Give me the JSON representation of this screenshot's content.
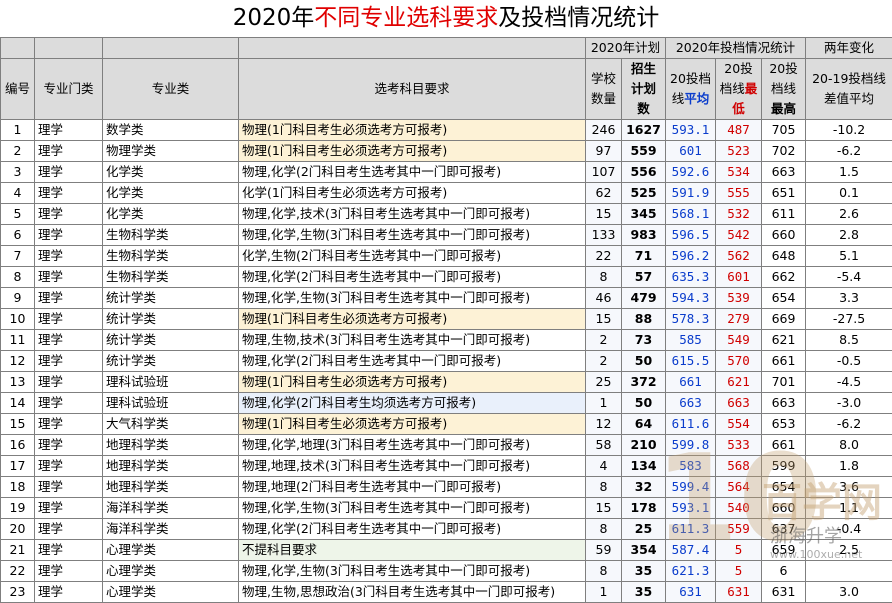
{
  "title": {
    "pre": "2020年",
    "highlight": "不同专业选科要求",
    "post": "及投档情况统计"
  },
  "headers": {
    "plan_group": "2020年计划",
    "admit_group": "2020年投档情况统计",
    "change_group": "两年变化",
    "no": "编号",
    "category": "专业门类",
    "major": "专业类",
    "requirement": "选考科目要求",
    "schools": "学校数量",
    "enroll": "招生计划数",
    "avg_prefix": "20投档线",
    "avg_suffix": "平均",
    "min_prefix": "20投档线",
    "min_suffix": "最低",
    "max_prefix": "20投档线",
    "max_suffix": "最高",
    "diff": "20-19投档线差值平均"
  },
  "rows": [
    {
      "no": "1",
      "category": "理学",
      "major": "数学类",
      "requirement": "物理(1门科目考生必须选考方可报考)",
      "schools": "246",
      "enroll": "1627",
      "avg": "593.1",
      "min": "487",
      "max": "705",
      "diff": "-10.2",
      "hl": "y"
    },
    {
      "no": "2",
      "category": "理学",
      "major": "物理学类",
      "requirement": "物理(1门科目考生必须选考方可报考)",
      "schools": "97",
      "enroll": "559",
      "avg": "601",
      "min": "523",
      "max": "702",
      "diff": "-6.2",
      "hl": "y"
    },
    {
      "no": "3",
      "category": "理学",
      "major": "化学类",
      "requirement": "物理,化学(2门科目考生选考其中一门即可报考)",
      "schools": "107",
      "enroll": "556",
      "avg": "592.6",
      "min": "534",
      "max": "663",
      "diff": "1.5",
      "hl": ""
    },
    {
      "no": "4",
      "category": "理学",
      "major": "化学类",
      "requirement": "化学(1门科目考生必须选考方可报考)",
      "schools": "62",
      "enroll": "525",
      "avg": "591.9",
      "min": "555",
      "max": "651",
      "diff": "0.1",
      "hl": ""
    },
    {
      "no": "5",
      "category": "理学",
      "major": "化学类",
      "requirement": "物理,化学,技术(3门科目考生选考其中一门即可报考)",
      "schools": "15",
      "enroll": "345",
      "avg": "568.1",
      "min": "532",
      "max": "611",
      "diff": "2.6",
      "hl": ""
    },
    {
      "no": "6",
      "category": "理学",
      "major": "生物科学类",
      "requirement": "物理,化学,生物(3门科目考生选考其中一门即可报考)",
      "schools": "133",
      "enroll": "983",
      "avg": "596.5",
      "min": "542",
      "max": "660",
      "diff": "2.8",
      "hl": ""
    },
    {
      "no": "7",
      "category": "理学",
      "major": "生物科学类",
      "requirement": "化学,生物(2门科目考生选考其中一门即可报考)",
      "schools": "22",
      "enroll": "71",
      "avg": "596.2",
      "min": "562",
      "max": "648",
      "diff": "5.1",
      "hl": ""
    },
    {
      "no": "8",
      "category": "理学",
      "major": "生物科学类",
      "requirement": "物理,化学(2门科目考生选考其中一门即可报考)",
      "schools": "8",
      "enroll": "57",
      "avg": "635.3",
      "min": "601",
      "max": "662",
      "diff": "-5.4",
      "hl": ""
    },
    {
      "no": "9",
      "category": "理学",
      "major": "统计学类",
      "requirement": "物理,化学,生物(3门科目考生选考其中一门即可报考)",
      "schools": "46",
      "enroll": "479",
      "avg": "594.3",
      "min": "539",
      "max": "654",
      "diff": "3.3",
      "hl": ""
    },
    {
      "no": "10",
      "category": "理学",
      "major": "统计学类",
      "requirement": "物理(1门科目考生必须选考方可报考)",
      "schools": "15",
      "enroll": "88",
      "avg": "578.3",
      "min": "279",
      "max": "669",
      "diff": "-27.5",
      "hl": "y"
    },
    {
      "no": "11",
      "category": "理学",
      "major": "统计学类",
      "requirement": "物理,生物,技术(3门科目考生选考其中一门即可报考)",
      "schools": "2",
      "enroll": "73",
      "avg": "585",
      "min": "549",
      "max": "621",
      "diff": "8.5",
      "hl": ""
    },
    {
      "no": "12",
      "category": "理学",
      "major": "统计学类",
      "requirement": "物理,化学(2门科目考生选考其中一门即可报考)",
      "schools": "2",
      "enroll": "50",
      "avg": "615.5",
      "min": "570",
      "max": "661",
      "diff": "-0.5",
      "hl": ""
    },
    {
      "no": "13",
      "category": "理学",
      "major": "理科试验班",
      "requirement": "物理(1门科目考生必须选考方可报考)",
      "schools": "25",
      "enroll": "372",
      "avg": "661",
      "min": "621",
      "max": "701",
      "diff": "-4.5",
      "hl": "y"
    },
    {
      "no": "14",
      "category": "理学",
      "major": "理科试验班",
      "requirement": "物理,化学(2门科目考生均须选考方可报考)",
      "schools": "1",
      "enroll": "50",
      "avg": "663",
      "min": "663",
      "max": "663",
      "diff": "-3.0",
      "hl": "b"
    },
    {
      "no": "15",
      "category": "理学",
      "major": "大气科学类",
      "requirement": "物理(1门科目考生必须选考方可报考)",
      "schools": "12",
      "enroll": "64",
      "avg": "611.6",
      "min": "554",
      "max": "653",
      "diff": "-6.2",
      "hl": "y"
    },
    {
      "no": "16",
      "category": "理学",
      "major": "地理科学类",
      "requirement": "物理,化学,地理(3门科目考生选考其中一门即可报考)",
      "schools": "58",
      "enroll": "210",
      "avg": "599.8",
      "min": "533",
      "max": "661",
      "diff": "8.0",
      "hl": ""
    },
    {
      "no": "17",
      "category": "理学",
      "major": "地理科学类",
      "requirement": "物理,地理,技术(3门科目考生选考其中一门即可报考)",
      "schools": "4",
      "enroll": "134",
      "avg": "583",
      "min": "568",
      "max": "599",
      "diff": "1.8",
      "hl": ""
    },
    {
      "no": "18",
      "category": "理学",
      "major": "地理科学类",
      "requirement": "物理,地理(2门科目考生选考其中一门即可报考)",
      "schools": "8",
      "enroll": "32",
      "avg": "599.4",
      "min": "564",
      "max": "654",
      "diff": "3.6",
      "hl": ""
    },
    {
      "no": "19",
      "category": "理学",
      "major": "海洋科学类",
      "requirement": "物理,化学,生物(3门科目考生选考其中一门即可报考)",
      "schools": "15",
      "enroll": "178",
      "avg": "593.1",
      "min": "540",
      "max": "660",
      "diff": "1.1",
      "hl": ""
    },
    {
      "no": "20",
      "category": "理学",
      "major": "海洋科学类",
      "requirement": "物理,化学(2门科目考生选考其中一门即可报考)",
      "schools": "8",
      "enroll": "25",
      "avg": "611.3",
      "min": "559",
      "max": "637",
      "diff": "-0.4",
      "hl": ""
    },
    {
      "no": "21",
      "category": "理学",
      "major": "心理学类",
      "requirement": "不提科目要求",
      "schools": "59",
      "enroll": "354",
      "avg": "587.4",
      "min": "5",
      "max": "659",
      "diff": "2.5",
      "hl": "g"
    },
    {
      "no": "22",
      "category": "理学",
      "major": "心理学类",
      "requirement": "物理,化学,生物(3门科目考生选考其中一门即可报考)",
      "schools": "8",
      "enroll": "35",
      "avg": "621.3",
      "min": "5",
      "max": "6",
      "diff": "",
      "hl": ""
    },
    {
      "no": "23",
      "category": "理学",
      "major": "心理学类",
      "requirement": "物理,生物,思想政治(3门科目考生选考其中一门即可报考)",
      "schools": "1",
      "enroll": "35",
      "avg": "631",
      "min": "631",
      "max": "631",
      "diff": "3.0",
      "hl": ""
    }
  ],
  "watermark": {
    "brand": "百学网",
    "mark": "10",
    "social": "浙海升学",
    "url": "www.100xue.net"
  }
}
